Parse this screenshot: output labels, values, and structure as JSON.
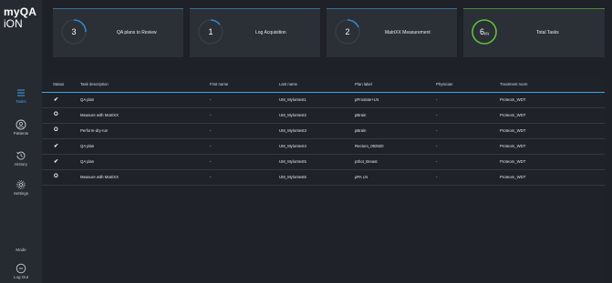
{
  "logo": {
    "line1_prefix": "my",
    "line1_suffix": "QA",
    "line2": "iON"
  },
  "sidebar": {
    "items": [
      {
        "label": "Tasks",
        "icon": "list-icon",
        "active": true
      },
      {
        "label": "Patients",
        "icon": "patients-icon",
        "active": false
      },
      {
        "label": "History",
        "icon": "history-icon",
        "active": false
      },
      {
        "label": "Settings",
        "icon": "gear-icon",
        "active": false
      }
    ],
    "mode_label": "Mode",
    "logout_label": "Log Out"
  },
  "cards": [
    {
      "count": "3",
      "count_sub": "",
      "label": "QA plans to Review",
      "ring_color": "#2f88c9"
    },
    {
      "count": "1",
      "count_sub": "",
      "label": "Log Acquisition",
      "ring_color": "#2f88c9"
    },
    {
      "count": "2",
      "count_sub": "",
      "label": "MatriXX Measurement",
      "ring_color": "#2f88c9"
    },
    {
      "count": "6",
      "count_sub": "(6)",
      "label": "Total Tasks",
      "ring_color": "#5fbf3c"
    }
  ],
  "table": {
    "headers": {
      "status": "Status",
      "task": "Task description",
      "first": "First name",
      "last": "Last name",
      "plan": "Plan label",
      "physician": "Physician",
      "room": "Treatment room"
    },
    "rows": [
      {
        "status": "✔",
        "task": "QA plan",
        "first": "-",
        "last": "UM_Mylontest1",
        "plan": "pProstate+LN",
        "physician": "-",
        "room": "Proteom_WDT"
      },
      {
        "status": "O",
        "task": "Measure with MatriXX",
        "first": "-",
        "last": "UM_Mylontest2",
        "plan": "pBrain",
        "physician": "-",
        "room": "Proteom_WDT"
      },
      {
        "status": "O",
        "task": "Perform-dry-run",
        "first": "-",
        "last": "UM_Mylontest3",
        "plan": "pBrain",
        "physician": "-",
        "room": "Proteom_WDT"
      },
      {
        "status": "✔",
        "task": "QA plan",
        "first": "-",
        "last": "UM_Mylontest4",
        "plan": "Rectum_092920",
        "physician": "-",
        "room": "Proteom_WDT"
      },
      {
        "status": "✔",
        "task": "QA plan",
        "first": "-",
        "last": "UM_Mylontest5",
        "plan": "pSlot_Breast",
        "physician": "-",
        "room": "Proteom_WDT"
      },
      {
        "status": "O",
        "task": "Measure with MatriXX",
        "first": "-",
        "last": "UM_Mylontest6",
        "plan": "pPA LN",
        "physician": "-",
        "room": "Proteom_WDT"
      }
    ]
  }
}
